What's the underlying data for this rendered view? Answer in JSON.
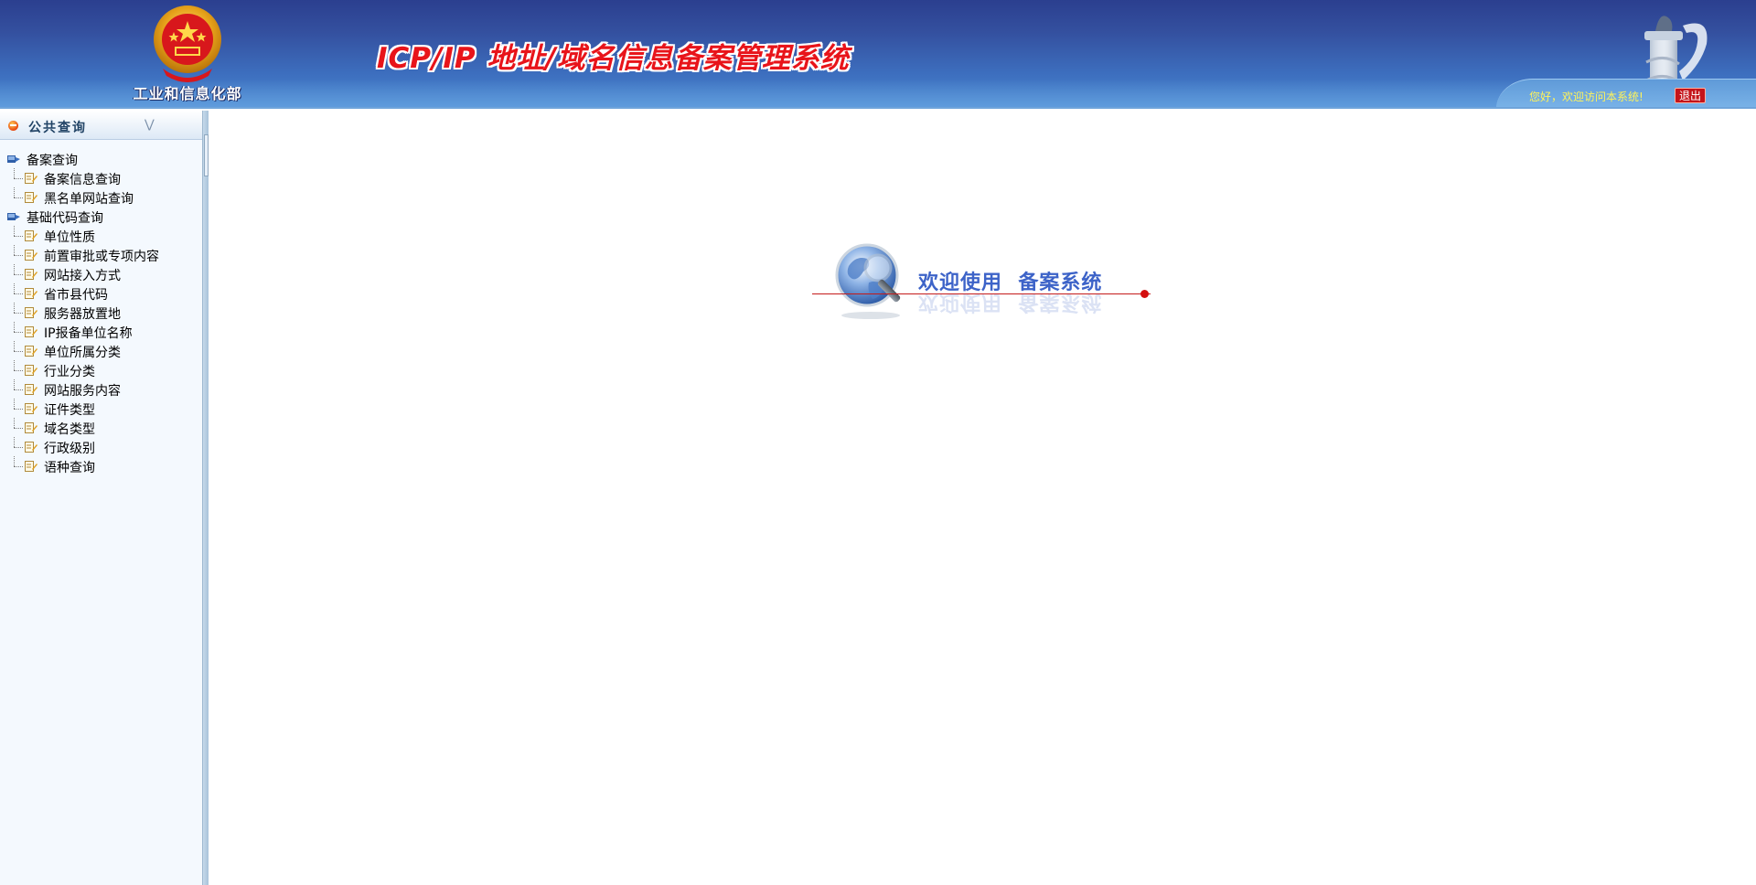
{
  "header": {
    "ministry": "工业和信息化部",
    "system_title": "ICP/IP 地址/域名信息备案管理系统",
    "greeting": "您好，欢迎访问本系统!",
    "logout_label": "退出",
    "colors": {
      "title_red": "#e8141a",
      "header_blue": "#34509f"
    }
  },
  "sidebar": {
    "panel_title": "公共查询",
    "groups": [
      {
        "label": "备案查询",
        "items": [
          "备案信息查询",
          "黑名单网站查询"
        ]
      },
      {
        "label": "基础代码查询",
        "items": [
          "单位性质",
          "前置审批或专项内容",
          "网站接入方式",
          "省市县代码",
          "服务器放置地",
          "IP报备单位名称",
          "单位所属分类",
          "行业分类",
          "网站服务内容",
          "证件类型",
          "域名类型",
          "行政级别",
          "语种查询"
        ]
      }
    ]
  },
  "main": {
    "welcome": "欢迎使用  备案系统",
    "colors": {
      "welcome_blue": "#3d63c8",
      "accent_red": "#d40f0f"
    }
  },
  "icons": {
    "emblem": "national-emblem-icon",
    "pillar": "huabiao-pillar-icon",
    "group": "folder-group-icon",
    "item": "document-item-icon",
    "globe": "globe-magnifier-icon"
  }
}
